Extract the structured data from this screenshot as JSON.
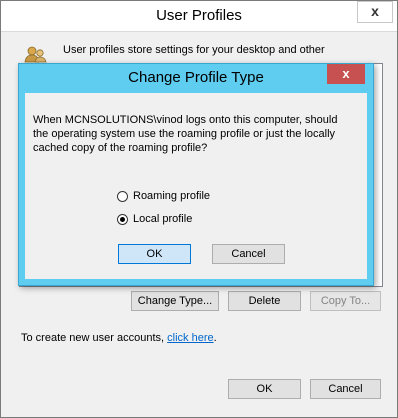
{
  "window": {
    "title": "User Profiles",
    "close_label": "x",
    "info_text": "User profiles store settings for your desktop and other",
    "change_type_label": "Change Type...",
    "delete_label": "Delete",
    "copy_to_label": "Copy To...",
    "create_prefix": "To create new user accounts, ",
    "create_link": "click here",
    "create_suffix": ".",
    "ok_label": "OK",
    "cancel_label": "Cancel"
  },
  "dialog": {
    "title": "Change Profile Type",
    "close_label": "x",
    "question_lines": [
      "When MCNSOLUTIONS\\vinod logs onto this computer, should",
      "the operating system use the roaming profile or just the locally",
      "cached copy of the roaming profile?"
    ],
    "options": [
      {
        "label": "Roaming profile",
        "checked": false
      },
      {
        "label": "Local profile",
        "checked": true
      }
    ],
    "ok_label": "OK",
    "cancel_label": "Cancel"
  },
  "colors": {
    "dialog_frame": "#5fcdf0",
    "close_button": "#c75050",
    "link": "#0066cc"
  },
  "icons": [
    "user-profile-icon",
    "close-icon"
  ]
}
